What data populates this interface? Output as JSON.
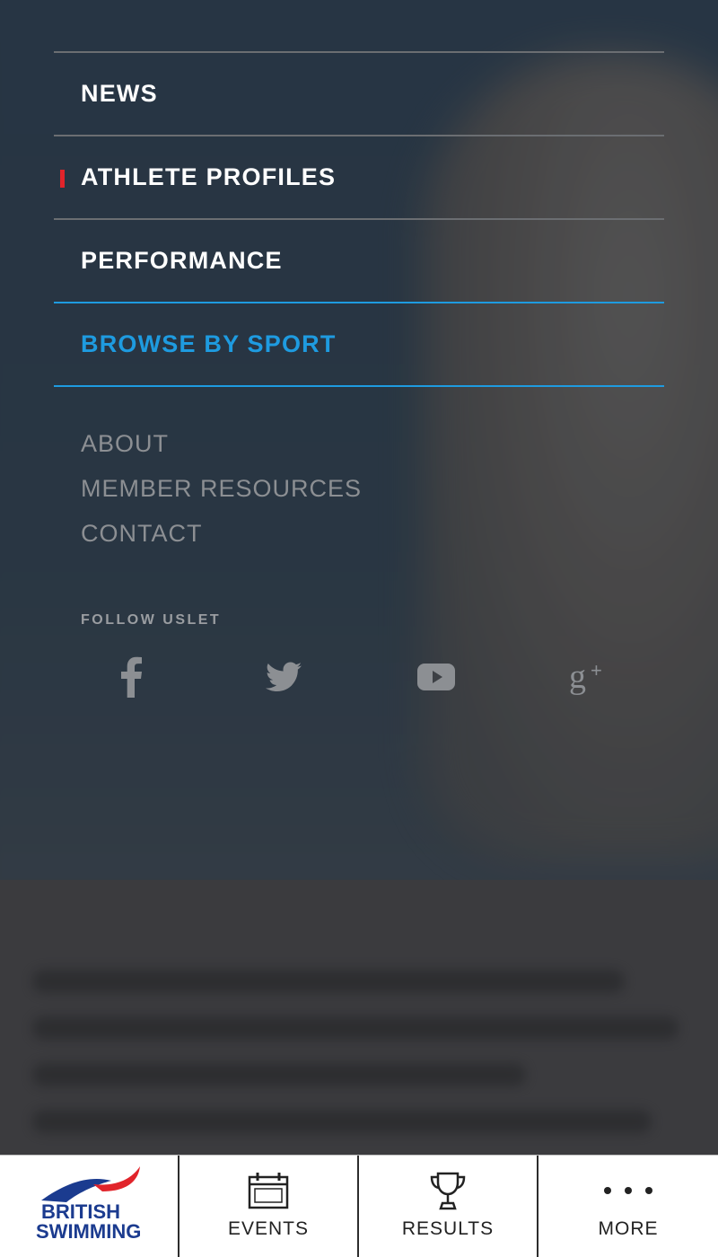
{
  "menu": {
    "primary": [
      {
        "label": "NEWS"
      },
      {
        "label": "ATHLETE PROFILES"
      },
      {
        "label": "PERFORMANCE"
      },
      {
        "label": "BROWSE BY SPORT"
      }
    ],
    "secondary": [
      {
        "label": "ABOUT"
      },
      {
        "label": "MEMBER RESOURCES"
      },
      {
        "label": "CONTACT"
      }
    ],
    "follow_label": "FOLLOW USLET",
    "social_icons": [
      "facebook-icon",
      "twitter-icon",
      "youtube-icon",
      "google-plus-icon"
    ]
  },
  "tabbar": {
    "logo_line1": "BRITISH",
    "logo_line2": "SWIMMING",
    "events_label": "EVENTS",
    "results_label": "RESULTS",
    "more_label": "MORE"
  },
  "colors": {
    "accent_blue": "#1e9be0",
    "active_marker_red": "#e1242b",
    "logo_navy": "#1b3b8f"
  }
}
